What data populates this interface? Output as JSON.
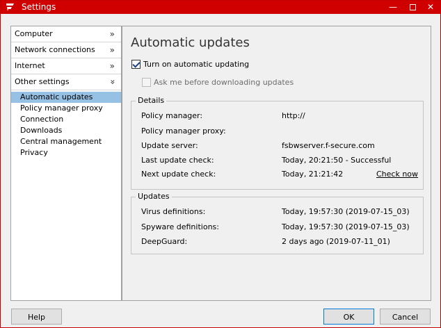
{
  "window": {
    "title": "Settings",
    "accent": "#d10000"
  },
  "sidebar": {
    "categories": [
      {
        "label": "Computer",
        "chevron": "»"
      },
      {
        "label": "Network connections",
        "chevron": "»"
      },
      {
        "label": "Internet",
        "chevron": "»"
      },
      {
        "label": "Other settings",
        "chevron": "«"
      }
    ],
    "sub_items": [
      {
        "label": "Automatic updates",
        "selected": true
      },
      {
        "label": "Policy manager proxy"
      },
      {
        "label": "Connection"
      },
      {
        "label": "Downloads"
      },
      {
        "label": "Central management"
      },
      {
        "label": "Privacy"
      }
    ]
  },
  "main": {
    "title": "Automatic updates",
    "auto_update_label": "Turn on automatic updating",
    "auto_update_checked": true,
    "ask_label": "Ask me before downloading updates",
    "ask_checked": false,
    "details": {
      "legend": "Details",
      "rows": [
        {
          "label": "Policy manager:",
          "value": "http://"
        },
        {
          "label": "Policy manager proxy:",
          "value": ""
        },
        {
          "label": "Update server:",
          "value": "fsbwserver.f-secure.com"
        },
        {
          "label": "Last update check:",
          "value": "Today, 20:21:50 - Successful"
        },
        {
          "label": "Next update check:",
          "value": "Today, 21:21:42"
        }
      ],
      "check_now_label": "Check now"
    },
    "updates": {
      "legend": "Updates",
      "rows": [
        {
          "label": "Virus definitions:",
          "value": "Today, 19:57:30 (2019-07-15_03)"
        },
        {
          "label": "Spyware definitions:",
          "value": "Today, 19:57:30 (2019-07-15_03)"
        },
        {
          "label": "DeepGuard:",
          "value": "2 days ago (2019-07-11_01)"
        }
      ]
    }
  },
  "footer": {
    "help_label": "Help",
    "ok_label": "OK",
    "cancel_label": "Cancel"
  }
}
